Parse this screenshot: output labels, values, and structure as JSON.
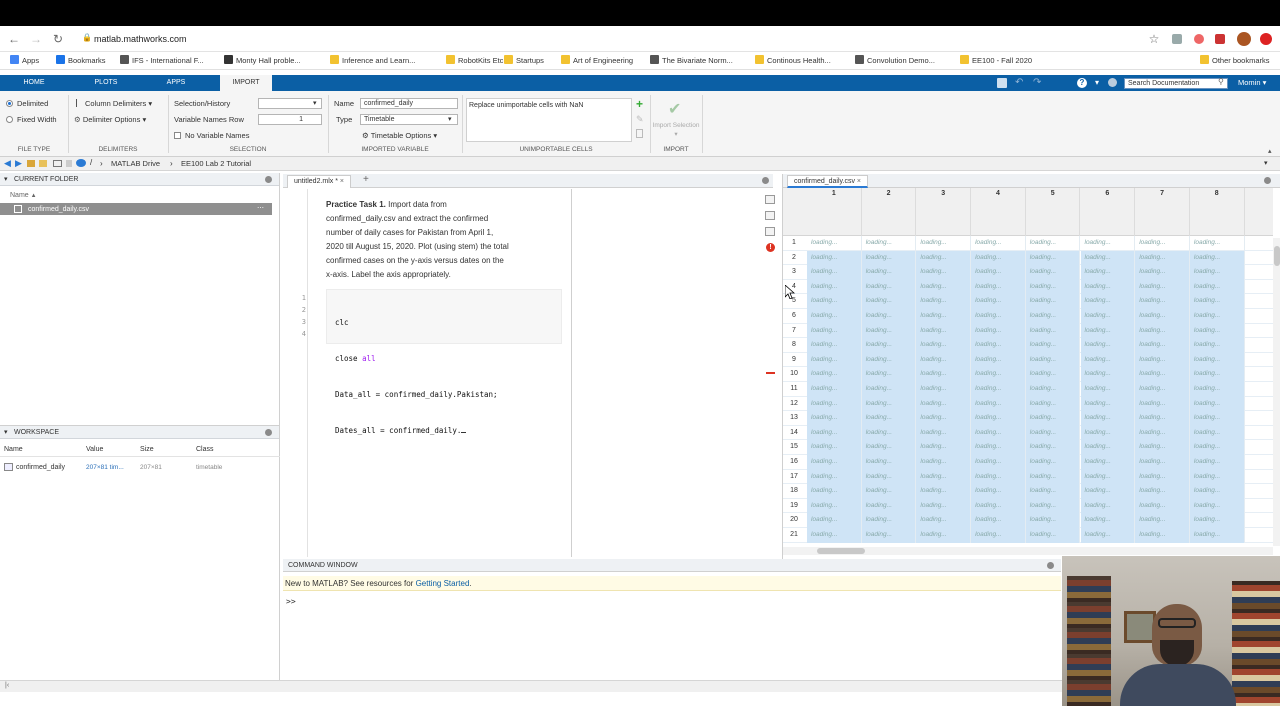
{
  "browser": {
    "url": "matlab.mathworks.com",
    "bookmarks": [
      {
        "label": "Apps",
        "color": "#4285f4"
      },
      {
        "label": "Bookmarks",
        "color": "#1a73e8"
      },
      {
        "label": "IFS - International F...",
        "color": "#555555"
      },
      {
        "label": "Monty Hall proble...",
        "color": "#333333"
      },
      {
        "label": "Inference and Learn...",
        "color": "#f2c230"
      },
      {
        "label": "RobotKits Etc",
        "color": "#f2c230"
      },
      {
        "label": "Startups",
        "color": "#f2c230"
      },
      {
        "label": "Art of Engineering",
        "color": "#f2c230"
      },
      {
        "label": "The Bivariate Norm...",
        "color": "#555555"
      },
      {
        "label": "Continous Health...",
        "color": "#f2c230"
      },
      {
        "label": "Convolution Demo...",
        "color": "#555555"
      },
      {
        "label": "EE100 - Fall 2020",
        "color": "#f2c230"
      },
      {
        "label": "Other bookmarks",
        "color": "#f2c230"
      }
    ]
  },
  "toolstrip": {
    "tabs": [
      "HOME",
      "PLOTS",
      "APPS",
      "IMPORT"
    ],
    "search_placeholder": "Search Documentation",
    "user": "Momin",
    "file_type": {
      "delimited": "Delimited",
      "fixed_width": "Fixed Width",
      "label": "FILE TYPE"
    },
    "delimiters": {
      "column": "Column Delimiters",
      "options": "Delimiter Options",
      "label": "DELIMITERS"
    },
    "selection": {
      "history": "Selection/History",
      "var_names_row": "Variable Names Row",
      "var_names_row_value": "1",
      "no_var_names": "No Variable Names",
      "label": "SELECTION"
    },
    "imported_variable": {
      "name_label": "Name",
      "name_value": "confirmed_daily",
      "type_label": "Type",
      "type_value": "Timetable",
      "options": "Timetable Options",
      "label": "IMPORTED VARIABLE"
    },
    "unimportable": {
      "rule": "Replace unimportable cells with NaN",
      "label": "UNIMPORTABLE CELLS"
    },
    "import": {
      "button": "Import Selection",
      "label": "IMPORT"
    }
  },
  "pathbar": {
    "crumbs": [
      "MATLAB Drive",
      "EE100 Lab 2 Tutorial"
    ]
  },
  "current_folder": {
    "title": "CURRENT FOLDER",
    "col_name": "Name",
    "files": [
      "confirmed_daily.csv"
    ]
  },
  "workspace": {
    "title": "WORKSPACE",
    "columns": [
      "Name",
      "Value",
      "Size",
      "Class"
    ],
    "rows": [
      {
        "name": "confirmed_daily",
        "value": "207×81 tim...",
        "size": "207×81",
        "class": "timetable"
      }
    ]
  },
  "editor": {
    "tab": "untitled2.mlx *",
    "task_title": "Practice Task 1.",
    "task_text_lines": [
      " Import data from",
      "confirmed_daily.csv and extract the confirmed",
      "number of daily cases for Pakistan from April 1,",
      "2020 till August 15, 2020. Plot (using stem) the total",
      "confirmed cases on the y-axis versus dates on the",
      "x-axis. Label the axis appropriately."
    ],
    "code_lines": [
      {
        "num": "1",
        "text": "clc",
        "kw": ""
      },
      {
        "num": "2",
        "text": "close ",
        "kw": "all"
      },
      {
        "num": "3",
        "text": "Data_all = confirmed_daily.Pakistan;",
        "kw": ""
      },
      {
        "num": "4",
        "text": "Dates_all = confirmed_daily.",
        "kw": ""
      }
    ]
  },
  "spreadsheet": {
    "tab": "confirmed_daily.csv",
    "columns": [
      "1",
      "2",
      "3",
      "4",
      "5",
      "6",
      "7",
      "8"
    ],
    "rows": [
      "1",
      "2",
      "3",
      "4",
      "5",
      "6",
      "7",
      "8",
      "9",
      "10",
      "11",
      "12",
      "13",
      "14",
      "15",
      "16",
      "17",
      "18",
      "19",
      "20",
      "21"
    ],
    "cell_text": "loading..."
  },
  "command_window": {
    "title": "COMMAND WINDOW",
    "banner_text": "New to MATLAB? See resources for ",
    "banner_link": "Getting Started",
    "banner_end": ".",
    "prompt": ">>"
  }
}
